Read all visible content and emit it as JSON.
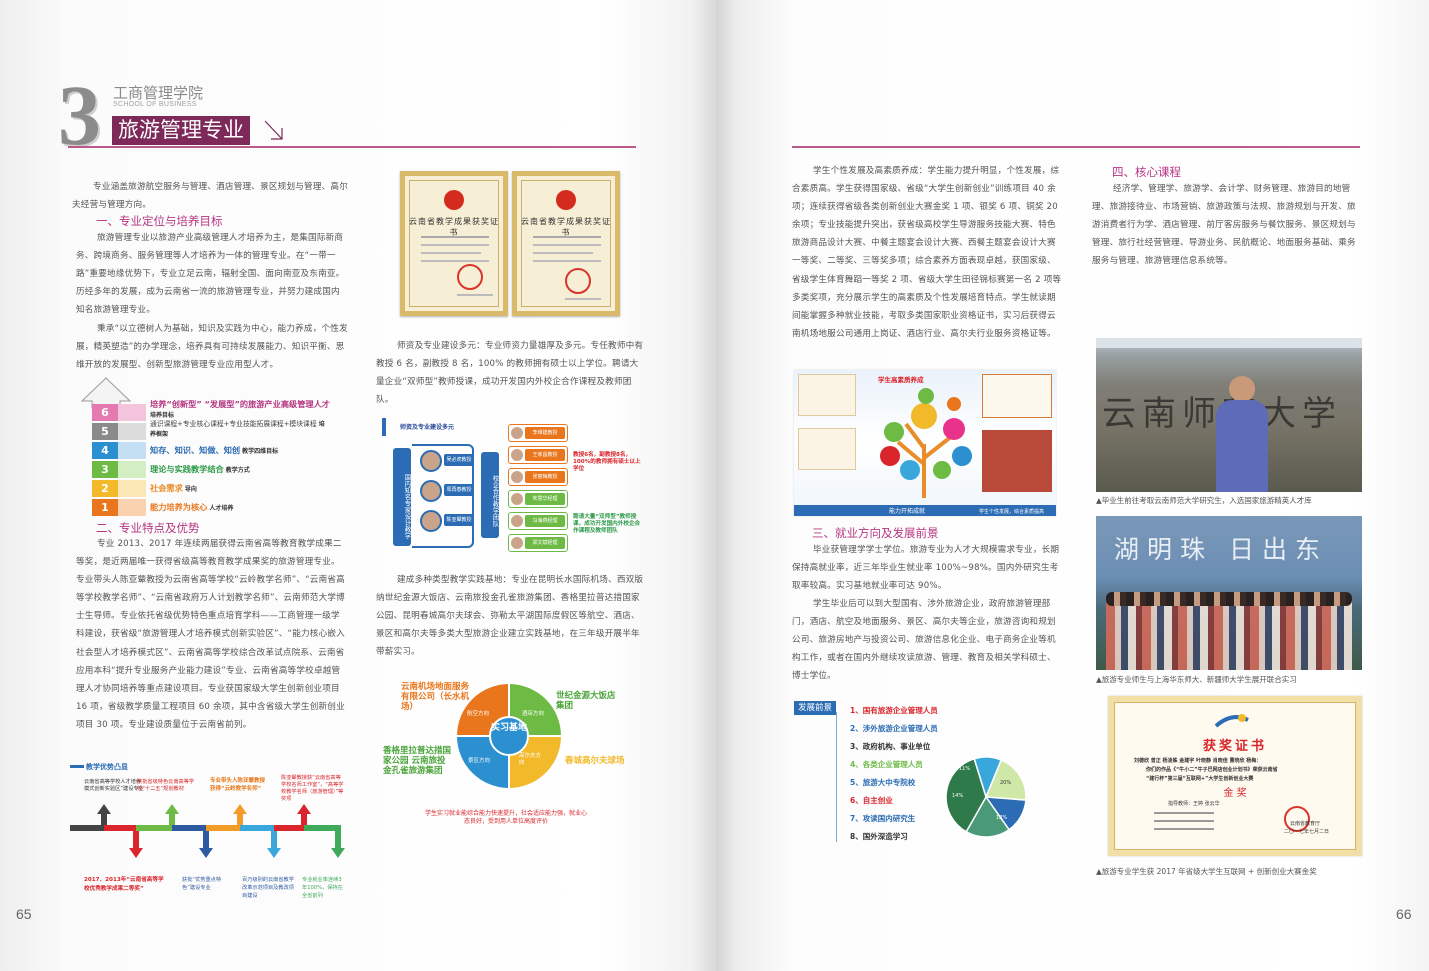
{
  "left": {
    "header": {
      "number": "3",
      "college_cn": "工商管理学院",
      "college_en": "SCHOOL OF BUSINESS",
      "major": "旅游管理专业"
    },
    "intro": "专业涵盖旅游航空服务与管理、酒店管理、景区规划与管理、高尔夫经营与管理方向。",
    "sec1": {
      "title": "一、专业定位与培养目标",
      "p1": "旅游管理专业以旅游产业高级管理人才培养为主，是集国际新商务、跨境商务、服务管理等人才培养为一体的管理专业。在“一带一路”重要地缘优势下，专业立足云南，辐射全国、面向南亚及东南亚。历经多年的发展，成为云南省一流的旅游管理专业，并努力建成国内知名旅游管理专业。",
      "p2": "秉承“以立德树人为基础，知识及实践为中心，能力养成，个性发展，精英塑造”的办学理念，培养具有可持续发展能力、知识平衡、思维开放的发展型、创新型旅游管理专业应用型人才。"
    },
    "pyramid": [
      {
        "n": "6",
        "text": "培养“创新型” “发展型”的旅游产业高级管理人才|培养目标"
      },
      {
        "n": "5",
        "text": "通识课程+专业核心课程+专业技能拓展课程+模块课程|培养框架"
      },
      {
        "n": "4",
        "text": "知存、知识、知做、知创|教学四维目标"
      },
      {
        "n": "3",
        "text": "理论与实践教学结合|教学方式"
      },
      {
        "n": "2",
        "text": "社会需求|导向"
      },
      {
        "n": "1",
        "text": "能力培养为核心|人才培养"
      }
    ],
    "sec2": {
      "title": "二、专业特点及优势",
      "p1": "专业 2013、2017 年连续两届获得云南省高等教育教学成果二等奖，是近两届唯一获得省级高等教育教学成果奖的旅游管理专业。专业带头人陈亚颦教授为云南省高等学校“云岭教学名师”、“云南省高等学校教学名师”、“云南省政府万人计划教学名师”、云南师范大学博士生导师。专业依托省级优势特色重点培育学科——工商管理一级学科建设，获省级“旅游管理人才培养模式创新实验区”、“能力核心嵌入社会型人才培养模式区”、云南省高等学校综合改革试点院系、云南省应用本科“提升专业服务产业能力建设”专业、云南省高等学校卓越管理人才协同培养等重点建设项目。专业获国家级大学生创新创业项目 16 项，省级教学质量工程项目 60 余项，其中含省级大学生创新创业项目 30 项。专业建设质量位于云南省前列。"
    },
    "timeline": {
      "title": "教学优势凸显",
      "top": [
        "云南省高等学校人才培养模式创新实验区”建设专业",
        "获批省级特色云南高等学校“十二五”规划教材",
        "专业带头人陈亚颦教授获得“云岭教学名师”",
        "陈亚颦教授获“云南省高等学校名师工作室”，“高等学校教学名师（旅游管理）”等奖项"
      ],
      "bottom": [
        "2017、2013年“云南省高等学校优秀教学成果二等奖”",
        "获批“优势重点特色”建设专业",
        "百万级别的云南省教学改革示范项目及教改项目建设",
        "专业就业率连续3年100%，保持在全省前列"
      ]
    },
    "certs": [
      {
        "title": "云南省教学成果获奖证书"
      },
      {
        "title": "云南省教学成果获奖证书"
      }
    ],
    "sec_teachers": "师资及专业建设多元：专业师资力量雄厚及多元。专任教师中有教授 6 名，副教授 8 名，100% 的教师拥有硕士以上学位。聘请大量企业“双师型”教师授课，成功开发国内外校企合作课程及教师团队。",
    "team_chart": {
      "title": "师资及专业建设多元",
      "left_label": "国内知名专家设计教学",
      "mid_label": "校企合作教学团队",
      "experts": [
        "吴必虎教授",
        "周再春教授",
        "陈亚颦教授"
      ],
      "right_boxes": [
        "李维建教授",
        "王孝昌教授",
        "张丽梅教授",
        "朱慧华经理",
        "冯海燕经理",
        "郑文斌经理"
      ],
      "notes": [
        "教授6名，副教授8名，100%的教师拥有硕士以上学位",
        "聘请大量“双师型”教师授课，成功开发国内外校企合作课程及教师团队"
      ]
    },
    "sec_practice": "建成多种类型教学实践基地：专业在昆明长水国际机场、西双版纳世纪金源大饭店、云南旅投金孔雀旅游集团、香格里拉普达措国家公园、昆明春城高尔夫球会、弥勒太平湖国际度假区等航空、酒店、景区和高尔夫等多类大型旅游企业建立实践基地，在三年级开展半年带薪实习。",
    "practice_diagram": {
      "center": "实习基地",
      "labels": [
        "航空方向",
        "酒店方向",
        "高尔夫方向",
        "景区方向"
      ],
      "partners": [
        "云南机场地面服务有限公司（长水机场）",
        "世纪金源大饭店集团",
        "香格里拉普达措国家公园 云南旅投金孔雀旅游集团",
        "春城高尔夫球场"
      ],
      "bottom_note": "学生实习就业能综合能力快速提升，社会适应能力强，就业心态良好，受到用人单位高度评价"
    },
    "page_number": "65"
  },
  "right": {
    "p_quality": "学生个性发展及高素质养成：学生能力提升明显，个性发展，综合素质高。学生获得国家级、省级“大学生创新创业”训练项目 40 余项；连续获得省级各类创新创业大赛金奖 1 项、银奖 6 项、铜奖 20 余项；专业技能提升突出，获省级高校学生导游服务技能大赛、特色旅游商品设计大赛、中餐主题宴会设计大赛、西餐主题宴会设计大赛一等奖、二等奖、三等奖多项；综合素养方面表现卓越，获国家级、省级学生体育舞蹈一等奖 2 项、省级大学生田径锦标赛第一名 2 项等多类奖项，充分展示学生的高素质及个性发展培育特点。学生就读期间能掌握多种就业技能，考取多类国家职业资格证书，实习后获得云南机场地服公司通用上岗证、酒店行业、高尔夫行业服务资格证等。",
    "sec4": {
      "title": "四、核心课程",
      "p": "经济学、管理学、旅游学、会计学、财务管理、旅游目的地管理、旅游接待业、市场营销、旅游政策与法规、旅游规划与开发、旅游消费者行为学、酒店管理、前厅客房服务与餐饮服务、景区规划与管理、旅行社经营管理、导游业务、民航概论、地面服务基础、乘务服务与管理、旅游管理信息系统等。"
    },
    "growth_chart": {
      "title": "学生高素质养成",
      "bottom": "能力开拓成就",
      "bottom2": "学生个性发展，综合素质提高",
      "bubbles": [
        "比赛",
        "获奖",
        "活动",
        "就业",
        "个性",
        "交流",
        "社会心态",
        "国际视野",
        "综合素养"
      ]
    },
    "sec3": {
      "title": "三、就业方向及发展前景",
      "p1": "毕业获管理学学士学位。旅游专业为人才大规模需求专业，长期保持高就业率，近三年毕业生就业率 100%~98%。国内外研究生考取率较高。实习基地就业率可达 90%。",
      "p2": "学生毕业后可以到大型国有、涉外旅游企业，政府旅游管理部门，酒店、航空及地面服务、景区、高尔夫等企业，旅游咨询和规划公司、旅游房地产与投资公司、旅游信息化企业、电子商务企业等机构工作，或者在国内外继续攻读旅游、管理、教育及相关学科硕士、博士学位。"
    },
    "prospects": {
      "title": "发展前景",
      "items": [
        "国有旅游企业管理人员",
        "涉外旅游企业管理人员",
        "政府机构、事业单位",
        "各类企业管理人员",
        "旅游大中专院校",
        "自主创业",
        "攻读国内研究生",
        "国外深造学习"
      ],
      "pie_labels": [
        "11%",
        "20%",
        "14%",
        "18%"
      ],
      "pie_values": [
        11,
        20,
        14,
        18,
        37
      ]
    },
    "photo1": {
      "rock_text": "云南师范大学",
      "caption": "▲毕业生前往考取云南师范大学研究生，入选国家旅游精英人才库"
    },
    "photo2": {
      "banner_text": "湖明珠 日出东",
      "caption": "▲旅游专业师生与上海华东师大、新疆师大学生展开联合实习"
    },
    "award": {
      "title": "获奖证书",
      "line1": "刘德欣 曾正 杨凌姝 金建宇 叶晓静 肖晓佳 曹晓欣 杨梅：",
      "line2": "你们的作品《“牛小二”牛子巴网店创业计划书》荣获云南省",
      "line3": "“建行杯”第三届“互联网+”大学生创新创业大赛",
      "line4": "金 奖",
      "line5": "指导教师：王婷 张云华",
      "org1": "云南省教育厅",
      "date": "二〇一七年七月二日",
      "caption": "▲旅游专业学生获 2017 年省级大学生互联网 + 创新创业大赛金奖"
    },
    "page_number": "66"
  },
  "colors": {
    "magenta": "#b53683",
    "wine": "#7d2a5b",
    "rule": "#b95a8a",
    "blue": "#2b6cb4",
    "green": "#6dbb45",
    "orange": "#f29b26"
  }
}
